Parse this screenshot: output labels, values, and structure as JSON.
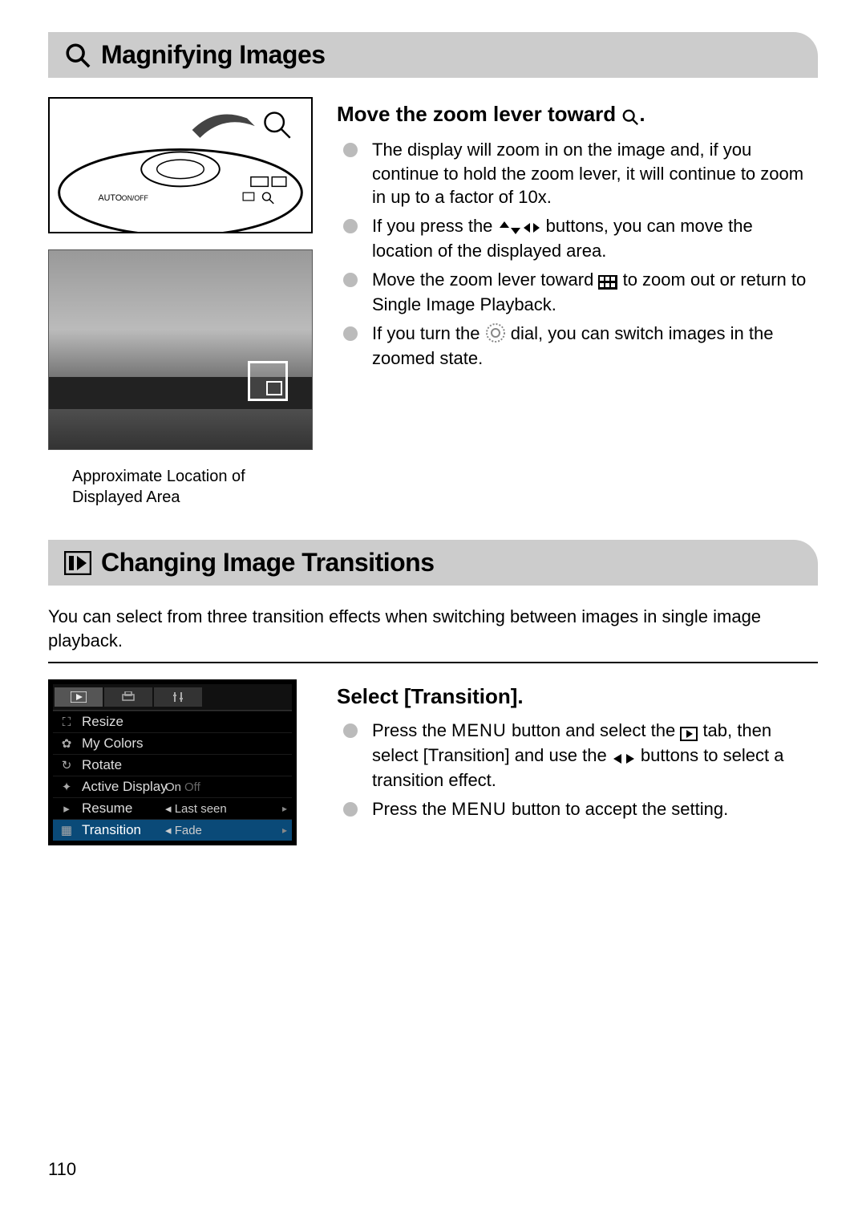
{
  "page_number": "110",
  "section1": {
    "title": "Magnifying Images",
    "caption": "Approximate Location of Displayed Area",
    "step_title_prefix": "Move the zoom lever toward ",
    "step_title_suffix": ".",
    "bullets": {
      "b1": "The display will zoom in on the image and, if you continue to hold the zoom lever, it will continue to zoom in up to a factor of 10x.",
      "b2_a": "If you press the ",
      "b2_b": " buttons, you can move the location of the displayed area.",
      "b3_a": "Move the zoom lever toward ",
      "b3_b": " to zoom out or return to Single Image Playback.",
      "b4_a": "If you turn the ",
      "b4_b": " dial, you can switch images in the zoomed state."
    }
  },
  "section2": {
    "title": "Changing Image Transitions",
    "intro": "You can select from three transition effects when switching between images in single image playback.",
    "step_title": "Select [Transition].",
    "bullets": {
      "b1_a": "Press the ",
      "b1_menu": "MENU",
      "b1_b": " button and select the ",
      "b1_c": " tab, then select [Transition] and use the ",
      "b1_d": " buttons to select a transition effect.",
      "b2_a": "Press the ",
      "b2_menu": "MENU",
      "b2_b": " button to accept the setting."
    },
    "menu": {
      "items": [
        {
          "label": "Resize",
          "value": ""
        },
        {
          "label": "My Colors",
          "value": ""
        },
        {
          "label": "Rotate",
          "value": ""
        },
        {
          "label": "Active Display",
          "value": "On",
          "off": "Off"
        },
        {
          "label": "Resume",
          "value": "◂ Last seen"
        },
        {
          "label": "Transition",
          "value": "◂ Fade"
        }
      ]
    }
  }
}
